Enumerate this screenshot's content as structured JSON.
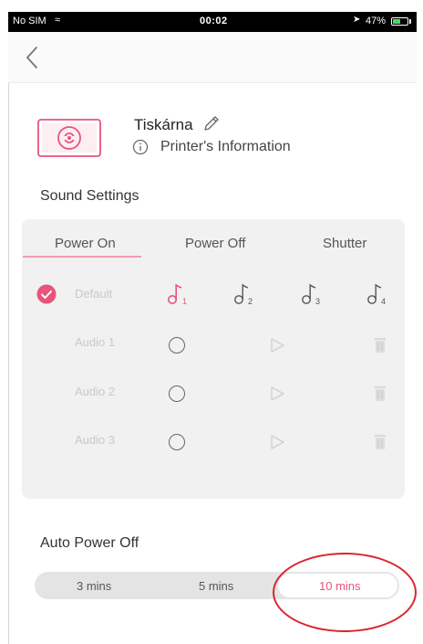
{
  "status_bar": {
    "carrier": "No SIM",
    "time": "00:02",
    "battery": "47%"
  },
  "printer": {
    "name": "Tiskárna",
    "info_label": "Printer's Information"
  },
  "sound": {
    "title": "Sound Settings",
    "tabs": [
      {
        "label": "Power On"
      },
      {
        "label": "Power Off"
      },
      {
        "label": "Shutter"
      }
    ],
    "rows": [
      {
        "label": "Default"
      },
      {
        "label": "Audio 1"
      },
      {
        "label": "Audio 2"
      },
      {
        "label": "Audio 3"
      }
    ],
    "note_numbers": [
      "1",
      "2",
      "3",
      "4"
    ]
  },
  "auto_power": {
    "title": "Auto Power Off",
    "options": [
      {
        "label": "3 mins"
      },
      {
        "label": "5 mins"
      },
      {
        "label": "10 mins"
      }
    ],
    "selected": "10 mins"
  },
  "colors": {
    "accent": "#e8547a",
    "annotation": "#d8262e",
    "panel": "#f1f1f1"
  }
}
